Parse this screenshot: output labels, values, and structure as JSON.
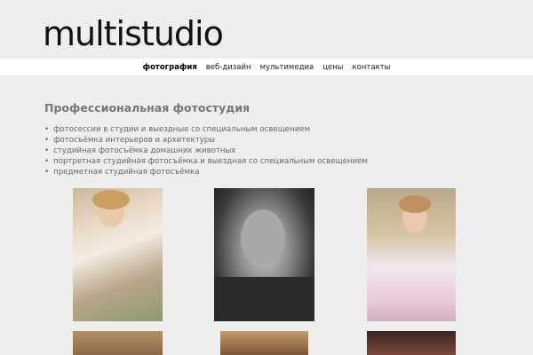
{
  "logo": "multistudio",
  "nav": [
    "фотография",
    "веб-дизайн",
    "мультимедиа",
    "цены",
    "контакты"
  ],
  "heading": "Профессиональная фотостудия",
  "services": [
    "фотосессии в студии и выездные со специальным освещением",
    "фотосъёмка интерьеров и архитектуры",
    "студийная фотосъёмка домашних животных",
    "портретная студийная фотосъёмка и выездная со специальным освещением",
    "предметная студийная фотосъёмка"
  ]
}
